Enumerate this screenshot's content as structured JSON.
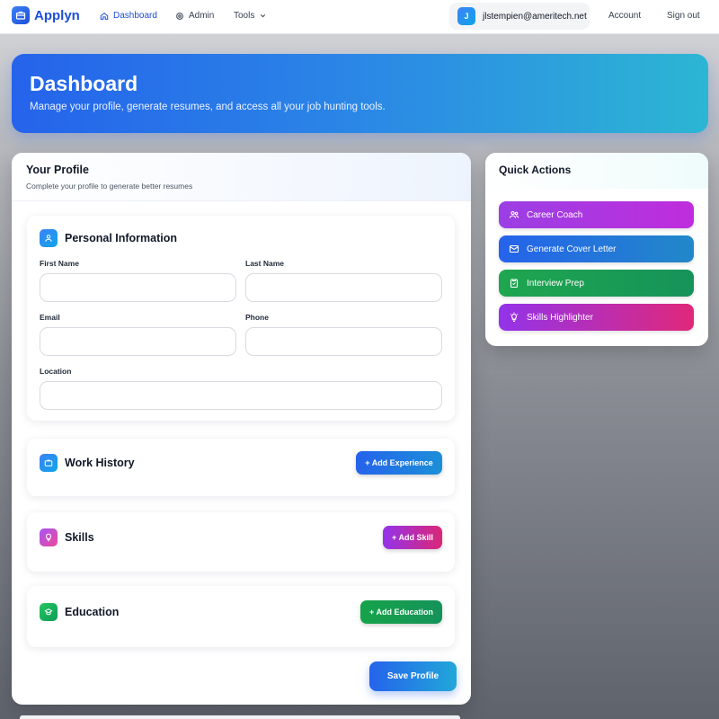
{
  "nav": {
    "brand": "Applyn",
    "links": [
      {
        "label": "Dashboard",
        "icon": "home-icon",
        "active": true
      },
      {
        "label": "Admin",
        "icon": "settings-icon",
        "active": false
      },
      {
        "label": "Tools",
        "icon": "chevron-down-icon",
        "active": false
      }
    ],
    "user": {
      "initial": "J",
      "email": "jlstempien@ameritech.net"
    },
    "account_label": "Account",
    "signout_label": "Sign out"
  },
  "hero": {
    "title": "Dashboard",
    "subtitle": "Manage your profile, generate resumes, and access all your job hunting tools."
  },
  "profile": {
    "title": "Your Profile",
    "subtitle": "Complete your profile to generate better resumes",
    "personal": {
      "title": "Personal Information",
      "icon": "user-icon",
      "fields": {
        "first_name": {
          "label": "First Name",
          "value": ""
        },
        "last_name": {
          "label": "Last Name",
          "value": ""
        },
        "email": {
          "label": "Email",
          "value": ""
        },
        "phone": {
          "label": "Phone",
          "value": ""
        },
        "location": {
          "label": "Location",
          "value": ""
        }
      }
    },
    "work": {
      "title": "Work History",
      "icon": "briefcase-icon",
      "button": "+ Add Experience"
    },
    "skills": {
      "title": "Skills",
      "icon": "lightbulb-icon",
      "button": "+ Add Skill"
    },
    "education": {
      "title": "Education",
      "icon": "graduation-icon",
      "button": "+ Add Education"
    },
    "save_label": "Save Profile"
  },
  "quick_actions": {
    "title": "Quick Actions",
    "items": [
      {
        "label": "Career Coach",
        "icon": "users-icon",
        "color": "#a43ae6"
      },
      {
        "label": "Generate Cover Letter",
        "icon": "mail-icon",
        "color": "#2a6fdc"
      },
      {
        "label": "Interview Prep",
        "icon": "clipboard-icon",
        "color": "#16a34a"
      },
      {
        "label": "Skills Highlighter",
        "icon": "lightbulb-icon",
        "color": "#db2777"
      }
    ]
  }
}
